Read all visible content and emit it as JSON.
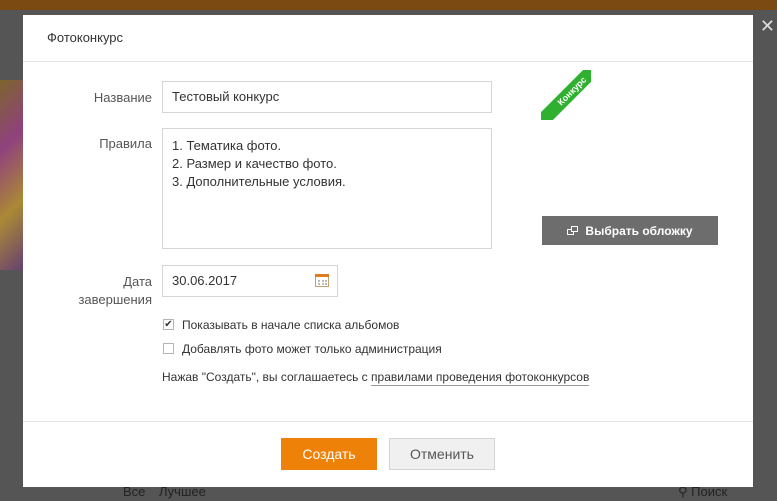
{
  "dialog": {
    "title": "Фотоконкурс",
    "name_label": "Название",
    "name_value": "Тестовый конкурс",
    "rules_label": "Правила",
    "rules_lines": [
      "1. Тематика фото.",
      "2. Размер и качество фото.",
      "3. Дополнительные условия."
    ],
    "date_label_line1": "Дата",
    "date_label_line2": "завершения",
    "date_value": "30.06.2017",
    "cover_ribbon": "Конкурс",
    "choose_cover_label": "Выбрать обложку",
    "checkbox_show_first": {
      "label": "Показывать в начале списка альбомов",
      "checked": true
    },
    "checkbox_admin_only": {
      "label": "Добавлять фото может только администрация",
      "checked": false
    },
    "agree_text": "Нажав \"Создать\", вы соглашаетесь с ",
    "agree_link": "правилами проведения фотоконкурсов",
    "create_button": "Создать",
    "cancel_button": "Отменить"
  },
  "background": {
    "bottom_bar": {
      "all": "Все",
      "best": "Лучшее",
      "search": "Поиск"
    },
    "close_glyph": "✕"
  },
  "colors": {
    "accent": "#ee8208",
    "ribbon": "#2fb12f",
    "cover_button": "#6d6d6d"
  }
}
